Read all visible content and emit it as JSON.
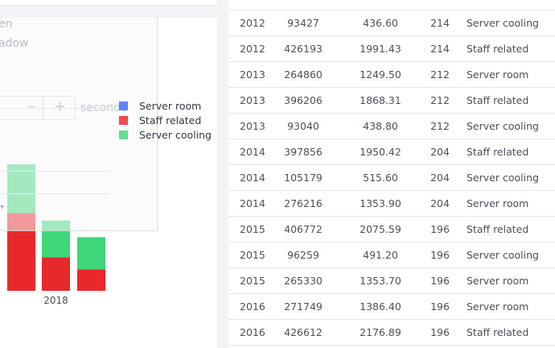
{
  "overlay": {
    "line1": "en",
    "line2": "adow",
    "stepper_minus": "−",
    "stepper_plus": "+",
    "unit": "seconds",
    "dropdown_icon": "chevron-down-icon"
  },
  "chart_data": {
    "type": "bar",
    "stacked": true,
    "categories": [
      "",
      "2018",
      ""
    ],
    "series": [
      {
        "name": "Server room",
        "color": "#5b86f2",
        "values": [
          0,
          0,
          0
        ]
      },
      {
        "name": "Staff related",
        "color": "#e8292b",
        "values": [
          1991,
          862,
          551
        ]
      },
      {
        "name": "Server cooling",
        "color": "#3dd77a",
        "values": [
          1250,
          938,
          823
        ]
      }
    ],
    "legend": [
      "Server room",
      "Staff related",
      "Server cooling"
    ],
    "xlabel": "",
    "ylabel": "",
    "legend_position": "top-right"
  },
  "table": {
    "rows": [
      [
        "2012",
        "93427",
        "436.60",
        "214",
        "Server cooling"
      ],
      [
        "2012",
        "426193",
        "1991.43",
        "214",
        "Staff related"
      ],
      [
        "2013",
        "264860",
        "1249.50",
        "212",
        "Server room"
      ],
      [
        "2013",
        "396206",
        "1868.31",
        "212",
        "Staff related"
      ],
      [
        "2013",
        "93040",
        "438.80",
        "212",
        "Server cooling"
      ],
      [
        "2014",
        "397856",
        "1950.42",
        "204",
        "Staff related"
      ],
      [
        "2014",
        "105179",
        "515.60",
        "204",
        "Server cooling"
      ],
      [
        "2014",
        "276216",
        "1353.90",
        "204",
        "Server room"
      ],
      [
        "2015",
        "406772",
        "2075.59",
        "196",
        "Staff related"
      ],
      [
        "2015",
        "96259",
        "491.20",
        "196",
        "Server cooling"
      ],
      [
        "2015",
        "265330",
        "1353.70",
        "196",
        "Server room"
      ],
      [
        "2016",
        "271749",
        "1386.40",
        "196",
        "Server room"
      ],
      [
        "2016",
        "426612",
        "2176.89",
        "196",
        "Staff related"
      ]
    ]
  }
}
